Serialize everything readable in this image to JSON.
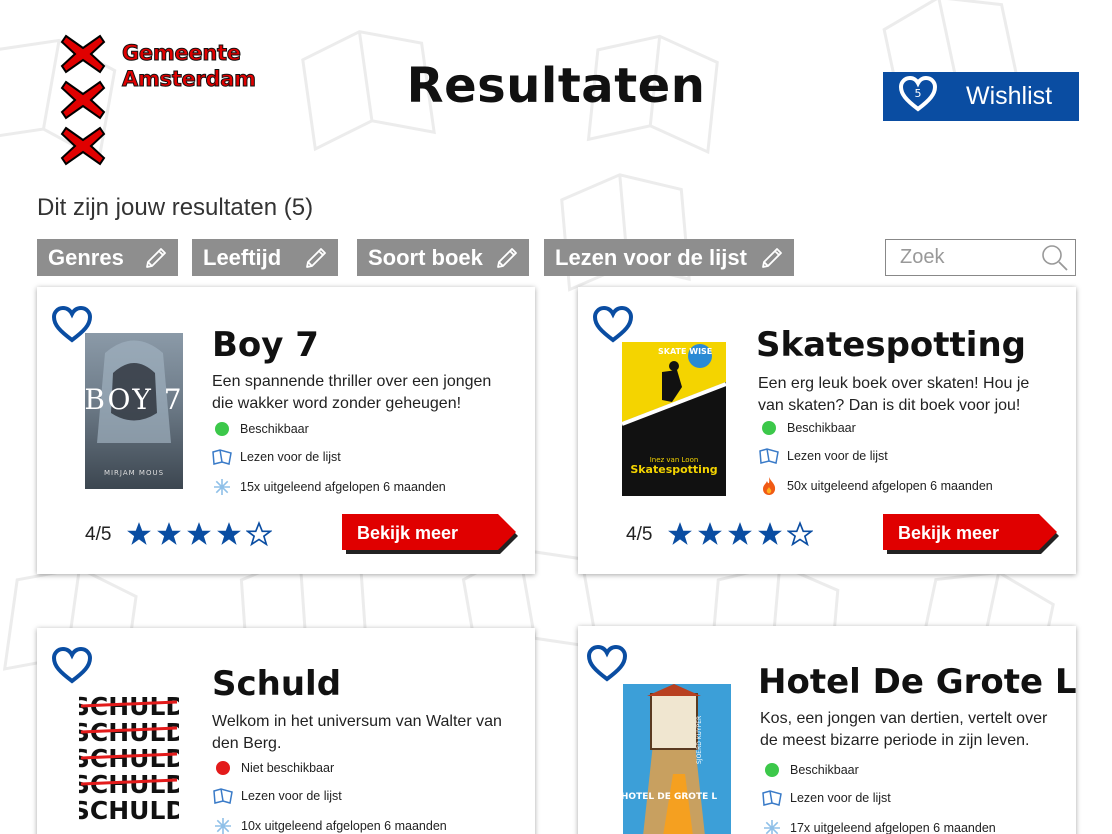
{
  "brand": {
    "line1": "Gemeente",
    "line2": "Amsterdam",
    "color": "#e00000"
  },
  "header": {
    "title": "Resultaten"
  },
  "wishlist": {
    "label": "Wishlist",
    "count": "5",
    "color": "#0a4da2"
  },
  "results": {
    "summary": "Dit zijn jouw resultaten (5)"
  },
  "filters": [
    {
      "label": "Genres"
    },
    {
      "label": "Leeftijd"
    },
    {
      "label": "Soort boek"
    },
    {
      "label": "Lezen voor de lijst"
    }
  ],
  "search": {
    "placeholder": "Zoek",
    "value": ""
  },
  "books": [
    {
      "title": "Boy 7",
      "description": "Een spannende thriller over een jongen die wakker word zonder geheugen!",
      "availability": "Beschikbaar",
      "availability_color": "#3cc84a",
      "list": "Lezen voor de lijst",
      "loans": "15x uitgeleend afgelopen 6 maanden",
      "loans_icon": "snowflake-icon",
      "rating": "4/5",
      "stars": 4,
      "button": "Bekijk meer",
      "cover_title": "BOY 7",
      "cover_author": "MIRJAM MOUS"
    },
    {
      "title": "Skatespotting",
      "description": "Een erg leuk boek over skaten! Hou je van skaten? Dan is dit boek voor jou!",
      "availability": "Beschikbaar",
      "availability_color": "#3cc84a",
      "list": "Lezen voor de lijst",
      "loans": "50x uitgeleend afgelopen 6 maanden",
      "loans_icon": "flame-icon",
      "rating": "4/5",
      "stars": 4,
      "button": "Bekijk meer",
      "cover_title": "Skatespotting",
      "cover_author": "Inez van Loon",
      "cover_series": "SKATE WISE"
    },
    {
      "title": "Schuld",
      "description": "Welkom in het universum van Walter van den Berg.",
      "availability": "Niet beschikbaar",
      "availability_color": "#e31b1b",
      "list": "Lezen voor de lijst",
      "loans": "10x uitgeleend afgelopen 6 maanden",
      "loans_icon": "snowflake-icon",
      "cover_title": "SCHULD"
    },
    {
      "title": "Hotel De Grote L",
      "description": "Kos, een jongen van dertien, vertelt over de meest bizarre periode in zijn leven.",
      "availability": "Beschikbaar",
      "availability_color": "#3cc84a",
      "list": "Lezen voor de lijst",
      "loans": "17x uitgeleend afgelopen 6 maanden",
      "loans_icon": "snowflake-icon",
      "cover_title": "HOTEL DE GROTE L",
      "cover_author": "SJOERD KUYPER"
    }
  ]
}
